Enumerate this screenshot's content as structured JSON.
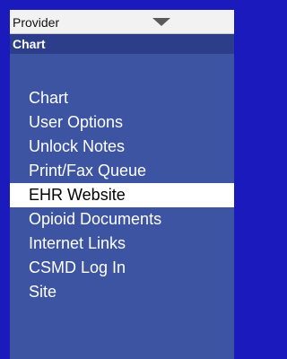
{
  "provider_select": {
    "value": "Provider",
    "icon": "chevron-down-icon"
  },
  "section": {
    "title": "Chart"
  },
  "menu": {
    "items": [
      {
        "label": "Chart",
        "active": false
      },
      {
        "label": "User Options",
        "active": false
      },
      {
        "label": "Unlock Notes",
        "active": false
      },
      {
        "label": "Print/Fax Queue",
        "active": false
      },
      {
        "label": "EHR Website",
        "active": true
      },
      {
        "label": "Opioid Documents",
        "active": false
      },
      {
        "label": "Internet Links",
        "active": false
      },
      {
        "label": "CSMD Log In",
        "active": false
      },
      {
        "label": "Site",
        "active": false
      }
    ]
  },
  "colors": {
    "outer_background": "#1b1bbd",
    "panel_background": "#3d54a3",
    "header_background": "#2c3d8a",
    "highlight_background": "#ffffff"
  }
}
